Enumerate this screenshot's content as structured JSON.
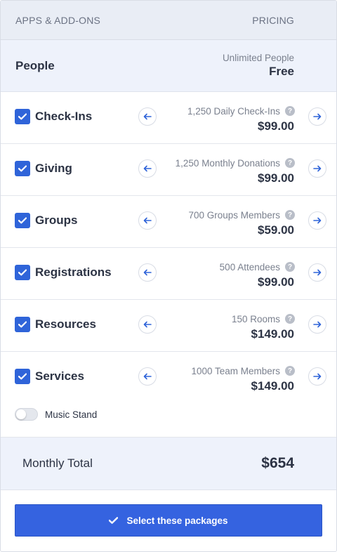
{
  "header": {
    "left_label": "APPS & ADD-ONS",
    "right_label": "PRICING"
  },
  "people": {
    "name": "People",
    "sub": "Unlimited People",
    "price": "Free"
  },
  "rows": [
    {
      "label": "Check-Ins",
      "qty": "1,250 Daily Check-Ins",
      "price": "$99.00",
      "checked": true
    },
    {
      "label": "Giving",
      "qty": "1,250 Monthly Donations",
      "price": "$99.00",
      "checked": true
    },
    {
      "label": "Groups",
      "qty": "700 Groups Members",
      "price": "$59.00",
      "checked": true
    },
    {
      "label": "Registrations",
      "qty": "500 Attendees",
      "price": "$99.00",
      "checked": true
    },
    {
      "label": "Resources",
      "qty": "150 Rooms",
      "price": "$149.00",
      "checked": true
    },
    {
      "label": "Services",
      "qty": "1000 Team Members",
      "price": "$149.00",
      "checked": true
    }
  ],
  "help_glyph": "?",
  "addon_toggle": {
    "label": "Music Stand",
    "on": false
  },
  "total": {
    "label": "Monthly Total",
    "value": "$654"
  },
  "select_button": {
    "label": "Select these packages"
  },
  "colors": {
    "accent": "#2f64d9",
    "button": "#3563e0",
    "header_bg": "#e9edf5",
    "highlight_bg": "#eef2fb"
  }
}
